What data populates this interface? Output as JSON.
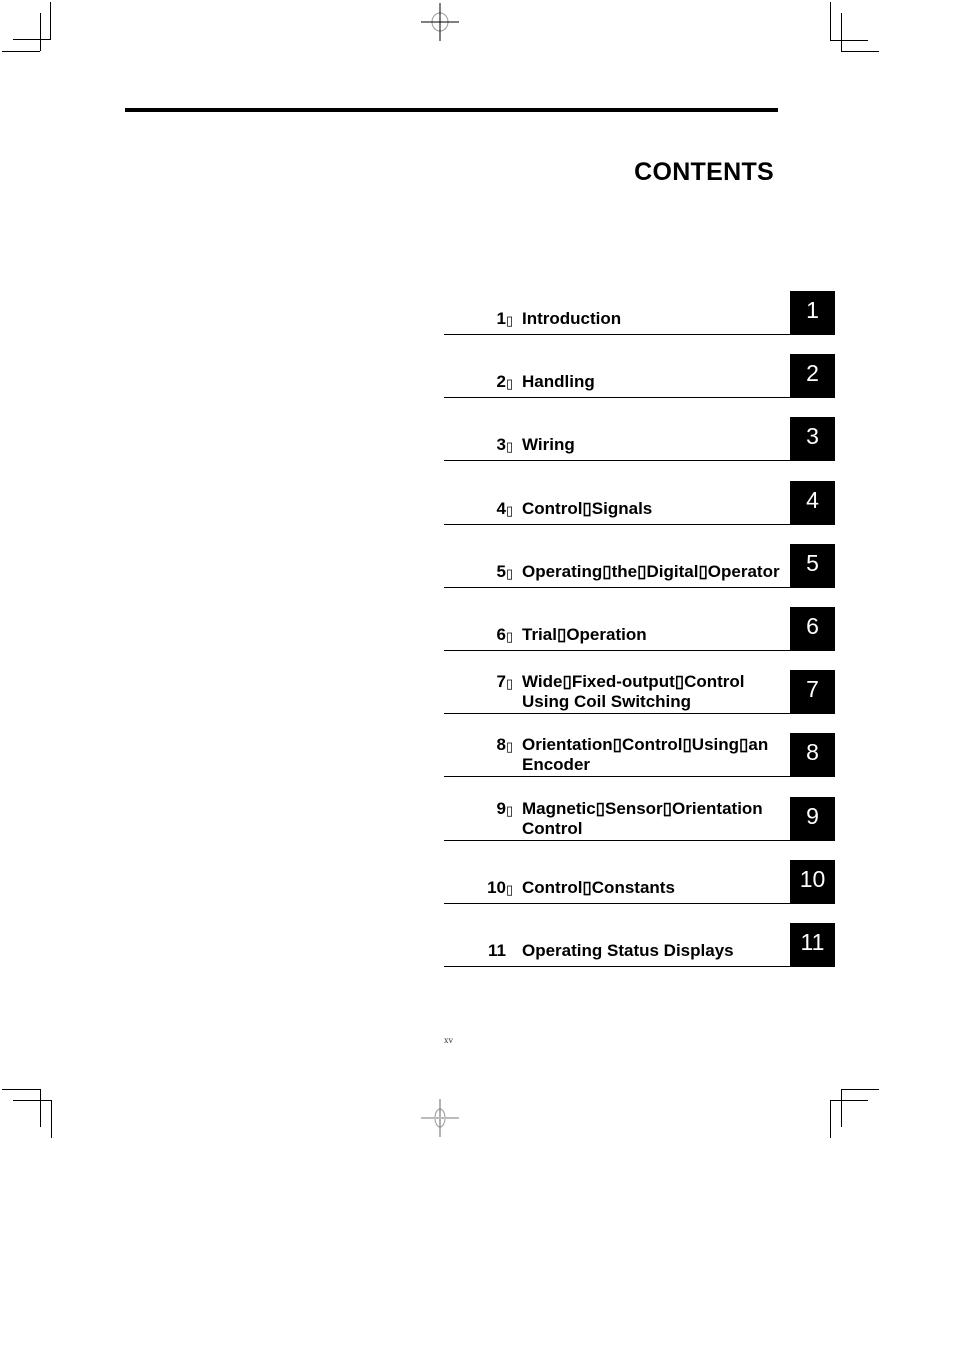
{
  "title": "CONTENTS",
  "toc": [
    {
      "number": "1",
      "sep": "▯",
      "lines": [
        "Introduction"
      ],
      "tab": "1"
    },
    {
      "number": "2",
      "sep": "▯",
      "lines": [
        "Handling"
      ],
      "tab": "2"
    },
    {
      "number": "3",
      "sep": "▯",
      "lines": [
        "Wiring"
      ],
      "tab": "3"
    },
    {
      "number": "4",
      "sep": "▯",
      "lines": [
        "Control▯Signals"
      ],
      "tab": "4"
    },
    {
      "number": "5",
      "sep": "▯",
      "lines": [
        "Operating▯the▯Digital▯Operator"
      ],
      "tab": "5"
    },
    {
      "number": "6",
      "sep": "▯",
      "lines": [
        "Trial▯Operation"
      ],
      "tab": "6"
    },
    {
      "number": "7",
      "sep": "▯",
      "lines": [
        "Wide▯Fixed-output▯Control",
        "Using Coil Switching"
      ],
      "tab": "7"
    },
    {
      "number": "8",
      "sep": "▯",
      "lines": [
        "Orientation▯Control▯Using▯an",
        "Encoder"
      ],
      "tab": "8"
    },
    {
      "number": "9",
      "sep": "▯",
      "lines": [
        "Magnetic▯Sensor▯Orientation",
        "Control"
      ],
      "tab": "9"
    },
    {
      "number": "10",
      "sep": "▯",
      "lines": [
        "Control▯Constants"
      ],
      "tab": "10"
    },
    {
      "number": "11",
      "sep": " ",
      "lines": [
        "Operating Status Displays"
      ],
      "tab": "11"
    }
  ],
  "page_number": "xv"
}
